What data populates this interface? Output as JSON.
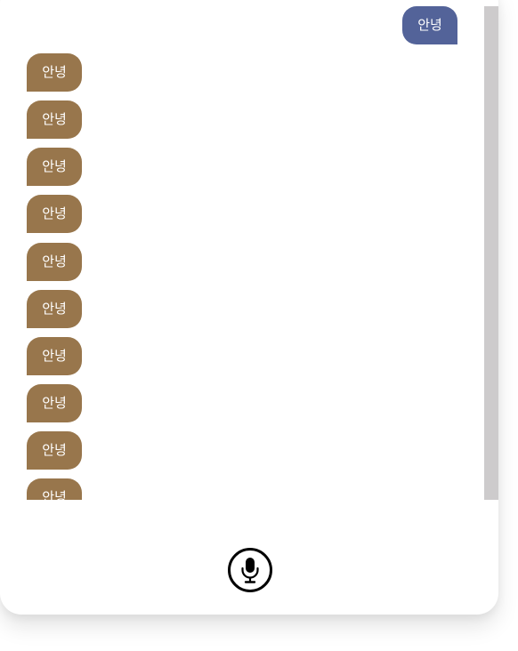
{
  "chat": {
    "sent": [
      {
        "text": "안녕"
      }
    ],
    "received": [
      {
        "text": "안녕"
      },
      {
        "text": "안녕"
      },
      {
        "text": "안녕"
      },
      {
        "text": "안녕"
      },
      {
        "text": "안녕"
      },
      {
        "text": "안녕"
      },
      {
        "text": "안녕"
      },
      {
        "text": "안녕"
      },
      {
        "text": "안녕"
      },
      {
        "text": "안녕"
      }
    ]
  },
  "colors": {
    "sent_bubble": "#536399",
    "received_bubble": "#98764c",
    "scrollbar_thumb": "#cdcbcc"
  },
  "controls": {
    "mic_icon": "microphone-icon"
  }
}
